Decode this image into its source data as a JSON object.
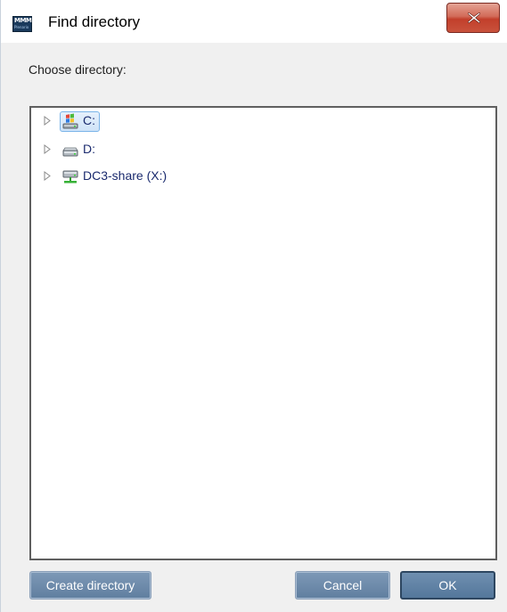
{
  "window": {
    "title": "Find directory",
    "app_icon_text": "MMM",
    "app_icon_subtext": "Plenario",
    "close_symbol": "×"
  },
  "prompt_label": "Choose directory:",
  "tree": {
    "items": [
      {
        "label": "C:",
        "icon": "windows-drive-icon",
        "selected": true
      },
      {
        "label": "D:",
        "icon": "hard-drive-icon",
        "selected": false
      },
      {
        "label": "DC3-share (X:)",
        "icon": "network-drive-icon",
        "selected": false
      }
    ]
  },
  "buttons": {
    "create_directory": "Create directory",
    "cancel": "Cancel",
    "ok": "OK"
  },
  "colors": {
    "close_button": "#c9523c",
    "button_blue": "#6f8fb0",
    "tree_item_text": "#1a2a6e",
    "selection": "#cfe3f8"
  }
}
